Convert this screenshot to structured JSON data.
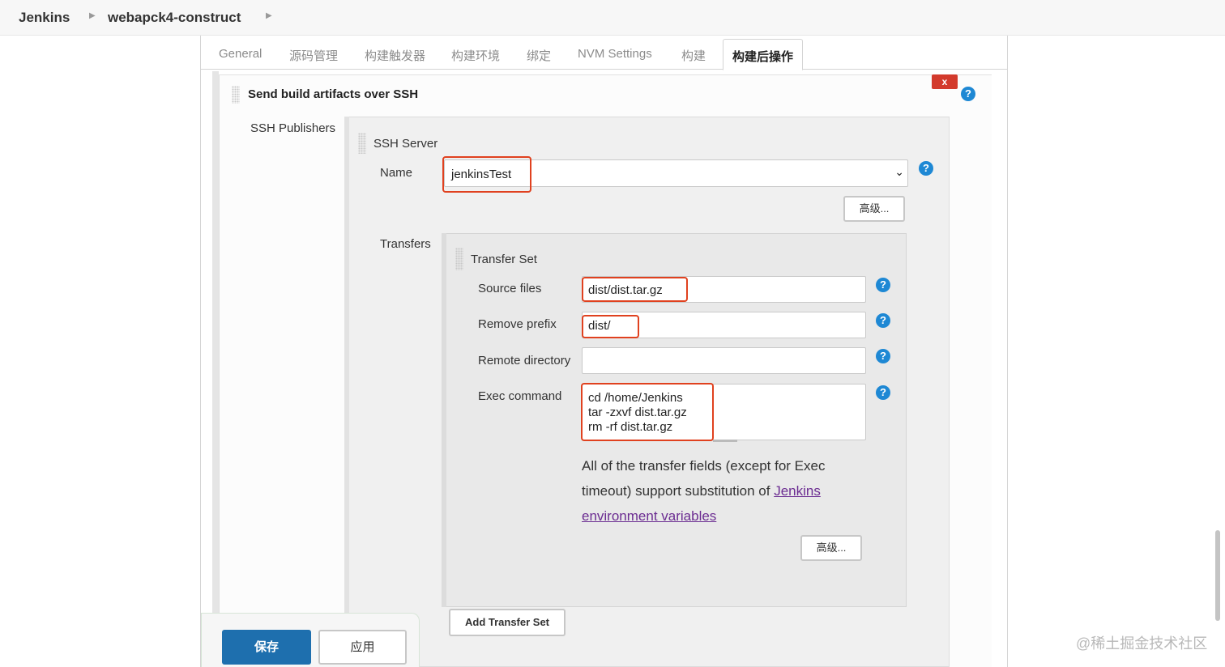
{
  "breadcrumb": {
    "root": "Jenkins",
    "job": "webapck4-construct"
  },
  "tabs": [
    "General",
    "源码管理",
    "构建触发器",
    "构建环境",
    "绑定",
    "NVM Settings",
    "构建",
    "构建后操作"
  ],
  "section": {
    "title": "Send build artifacts over SSH",
    "close_label": "x"
  },
  "ssh_publishers_label": "SSH Publishers",
  "ssh_server": {
    "title": "SSH Server",
    "name_label": "Name",
    "name_value": "jenkinsTest",
    "advanced_label": "高级..."
  },
  "transfers_label": "Transfers",
  "transfer_set": {
    "title": "Transfer Set",
    "source_files_label": "Source files",
    "source_files_value": "dist/dist.tar.gz",
    "remove_prefix_label": "Remove prefix",
    "remove_prefix_value": "dist/",
    "remote_directory_label": "Remote directory",
    "remote_directory_value": "",
    "exec_command_label": "Exec command",
    "exec_command_value": "cd /home/Jenkins\ntar -zxvf dist.tar.gz\nrm -rf dist.tar.gz",
    "help_text_1": "All of the transfer fields (except for Exec timeout) support substitution of ",
    "help_link": "Jenkins environment variables",
    "advanced_label": "高级..."
  },
  "add_transfer_set_label": "Add Transfer Set",
  "footer": {
    "save_label": "保存",
    "apply_label": "应用"
  },
  "help_icon_glyph": "?",
  "watermark": "@稀土掘金技术社区",
  "colors": {
    "accent": "#1e6fae",
    "highlight": "#e0411f",
    "help": "#1e88d4",
    "close": "#d33a2c",
    "link": "#6b2c91"
  }
}
